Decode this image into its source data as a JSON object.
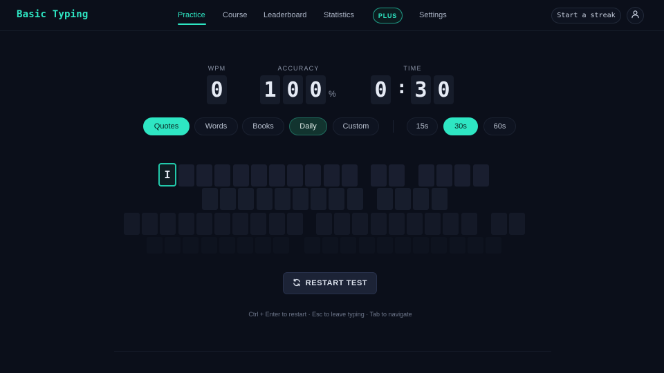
{
  "app": {
    "title": "Basic Typing"
  },
  "nav": {
    "items": [
      {
        "label": "Practice",
        "active": true
      },
      {
        "label": "Course",
        "active": false
      },
      {
        "label": "Leaderboard",
        "active": false
      },
      {
        "label": "Statistics",
        "active": false
      }
    ],
    "plus_label": "PLUS",
    "settings_label": "Settings"
  },
  "header": {
    "streak_label": "Start a streak",
    "account_icon": "user-icon"
  },
  "stats": {
    "wpm": {
      "label": "WPM",
      "digits": [
        "0"
      ]
    },
    "accuracy": {
      "label": "ACCURACY",
      "digits": [
        "1",
        "0",
        "0"
      ],
      "unit": "%"
    },
    "time": {
      "label": "TIME",
      "minutes": "0",
      "separator": ":",
      "seconds": [
        "3",
        "0"
      ]
    }
  },
  "modes": {
    "sources": [
      {
        "label": "Quotes",
        "state": "selected"
      },
      {
        "label": "Words",
        "state": "off"
      },
      {
        "label": "Books",
        "state": "off"
      },
      {
        "label": "Daily",
        "state": "highlighted"
      },
      {
        "label": "Custom",
        "state": "off"
      }
    ],
    "durations": [
      {
        "label": "15s",
        "state": "off"
      },
      {
        "label": "30s",
        "state": "selected"
      },
      {
        "label": "60s",
        "state": "off"
      }
    ]
  },
  "typing": {
    "current_char": "I",
    "words_hidden": true
  },
  "restart": {
    "label": "RESTART TEST",
    "icon": "refresh-icon"
  },
  "hint": {
    "text": "Ctrl + Enter to restart · Esc to leave typing · Tab to navigate"
  },
  "colors": {
    "accent": "#2ee6c3",
    "background": "#0b0f1a",
    "tile": "#161c2a"
  }
}
